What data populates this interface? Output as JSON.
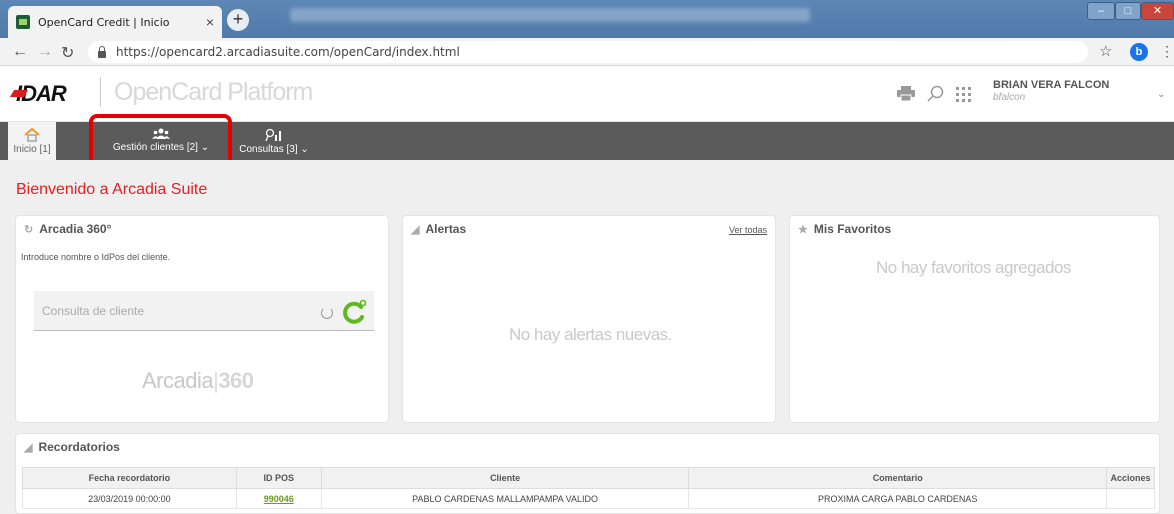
{
  "browser": {
    "tab_title": "OpenCard Credit | Inicio",
    "tab_close": "×",
    "new_tab": "+",
    "url": "https://opencard2.arcadiasuite.com/openCard/index.html",
    "profile_initial": "b"
  },
  "header": {
    "logo_text": "IDAR",
    "platform_title": "OpenCard Platform",
    "user_name": "BRIAN VERA FALCON",
    "user_login": "bfalcon"
  },
  "menu": {
    "inicio": "Inicio [1]",
    "gestion": "Gestión clientes [2] ⌄",
    "consultas": "Consultas [3] ⌄"
  },
  "welcome": "Bienvenido a Arcadia Suite",
  "arcadia360": {
    "title": "Arcadia 360°",
    "intro": "Introduce nombre o IdPos del cliente.",
    "placeholder": "Consulta de cliente",
    "logo_left": "Arcadia",
    "logo_right": "360"
  },
  "alertas": {
    "title": "Alertas",
    "ver_todas": "Ver todas",
    "empty": "No hay alertas nuevas."
  },
  "favoritos": {
    "title": "Mis Favoritos",
    "empty": "No hay favoritos agregados"
  },
  "recordatorios": {
    "title": "Recordatorios",
    "columns": [
      "Fecha recordatorio",
      "ID POS",
      "Cliente",
      "Comentario",
      "Acciones"
    ],
    "rows": [
      {
        "fecha": "23/03/2019 00:00:00",
        "id_pos": "990046",
        "cliente": "PABLO CARDENAS MALLAMPAMPA VALIDO",
        "comentario": "PROXIMA CARGA PABLO CARDENAS",
        "acciones": ""
      }
    ]
  },
  "colors": {
    "accent_red": "#e32020",
    "menubar": "#5b5b5b",
    "highlight": "#e60000",
    "link_green": "#6a9a1f"
  }
}
